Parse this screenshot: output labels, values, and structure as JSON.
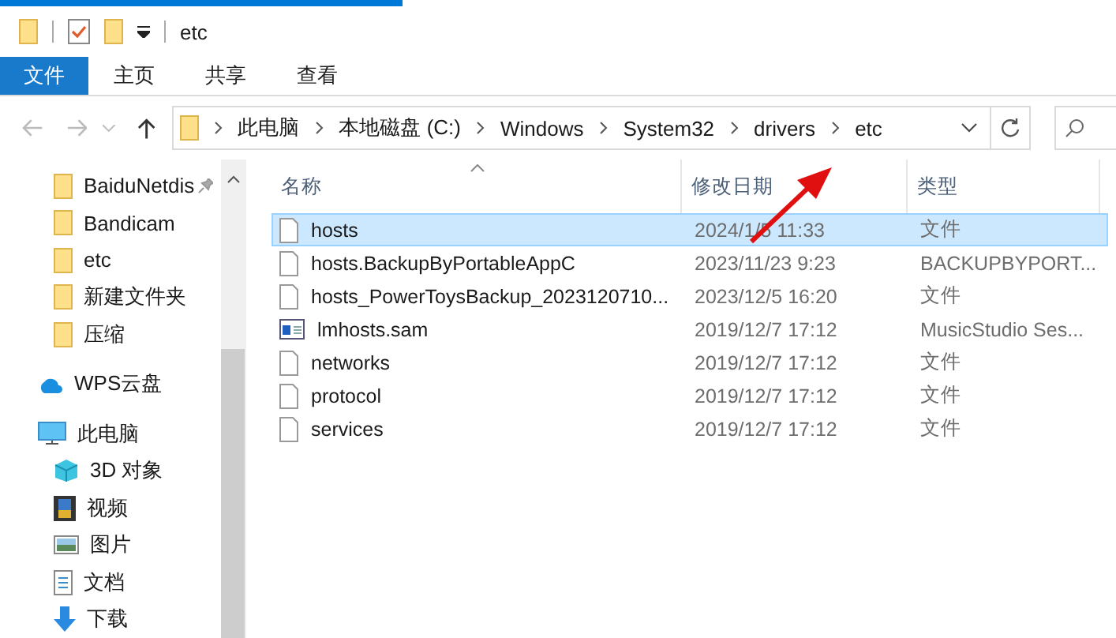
{
  "title_bar": {
    "title": "etc"
  },
  "ribbon_tabs": [
    {
      "label": "文件",
      "selected": true
    },
    {
      "label": "主页",
      "selected": false
    },
    {
      "label": "共享",
      "selected": false
    },
    {
      "label": "查看",
      "selected": false
    }
  ],
  "address_bar": {
    "breadcrumb": [
      "此电脑",
      "本地磁盘 (C:)",
      "Windows",
      "System32",
      "drivers",
      "etc"
    ]
  },
  "nav_pane": {
    "quick_access": [
      {
        "label": "BaiduNetdis",
        "pinned": true
      },
      {
        "label": "Bandicam",
        "pinned": false
      },
      {
        "label": "etc",
        "pinned": false
      },
      {
        "label": "新建文件夹",
        "pinned": false
      },
      {
        "label": "压缩",
        "pinned": false
      }
    ],
    "cloud": {
      "label": "WPS云盘"
    },
    "this_pc": {
      "label": "此电脑",
      "children": [
        {
          "label": "3D 对象",
          "kind": "cube"
        },
        {
          "label": "视频",
          "kind": "film"
        },
        {
          "label": "图片",
          "kind": "picture"
        },
        {
          "label": "文档",
          "kind": "document"
        },
        {
          "label": "下载",
          "kind": "download"
        }
      ]
    }
  },
  "file_list": {
    "columns": [
      "名称",
      "修改日期",
      "类型"
    ],
    "rows": [
      {
        "name": "hosts",
        "date": "2024/1/5 11:33",
        "type": "文件",
        "kind": "file",
        "selected": true
      },
      {
        "name": "hosts.BackupByPortableAppC",
        "date": "2023/11/23 9:23",
        "type": "BACKUPBYPORT...",
        "kind": "file",
        "selected": false
      },
      {
        "name": "hosts_PowerToysBackup_2023120710...",
        "date": "2023/12/5 16:20",
        "type": "文件",
        "kind": "file",
        "selected": false
      },
      {
        "name": "lmhosts.sam",
        "date": "2019/12/7 17:12",
        "type": "MusicStudio Ses...",
        "kind": "window",
        "selected": false
      },
      {
        "name": "networks",
        "date": "2019/12/7 17:12",
        "type": "文件",
        "kind": "file",
        "selected": false
      },
      {
        "name": "protocol",
        "date": "2019/12/7 17:12",
        "type": "文件",
        "kind": "file",
        "selected": false
      },
      {
        "name": "services",
        "date": "2019/12/7 17:12",
        "type": "文件",
        "kind": "file",
        "selected": false
      }
    ]
  }
}
